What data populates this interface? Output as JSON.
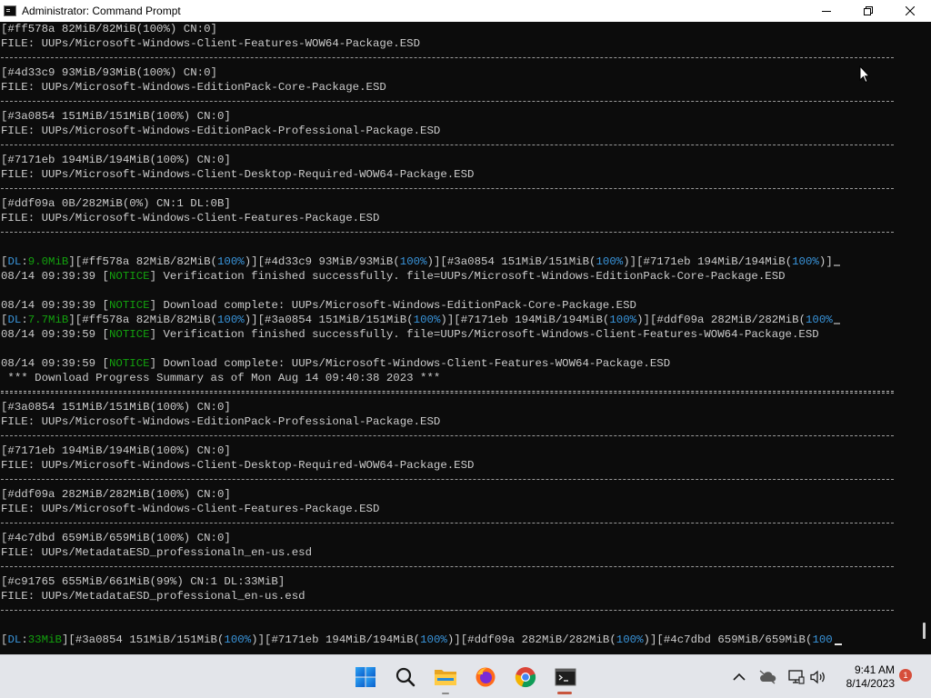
{
  "window": {
    "title": "Administrator: Command Prompt",
    "icon": "cmd-icon"
  },
  "console": {
    "blocks": [
      {
        "status": "[#ff578a 82MiB/82MiB(100%) CN:0]",
        "file": "FILE: UUPs/Microsoft-Windows-Client-Features-WOW64-Package.ESD"
      },
      {
        "status": "[#4d33c9 93MiB/93MiB(100%) CN:0]",
        "file": "FILE: UUPs/Microsoft-Windows-EditionPack-Core-Package.ESD"
      },
      {
        "status": "[#3a0854 151MiB/151MiB(100%) CN:0]",
        "file": "FILE: UUPs/Microsoft-Windows-EditionPack-Professional-Package.ESD"
      },
      {
        "status": "[#7171eb 194MiB/194MiB(100%) CN:0]",
        "file": "FILE: UUPs/Microsoft-Windows-Client-Desktop-Required-WOW64-Package.ESD"
      },
      {
        "status": "[#ddf09a 0B/282MiB(0%) CN:1 DL:0B]",
        "file": "FILE: UUPs/Microsoft-Windows-Client-Features-Package.ESD"
      }
    ],
    "progress1": {
      "dl": "9.0MiB",
      "items": [
        {
          "id": "#ff578a",
          "size": "82MiB/82MiB",
          "pct": "100%"
        },
        {
          "id": "#4d33c9",
          "size": "93MiB/93MiB",
          "pct": "100%"
        },
        {
          "id": "#3a0854",
          "size": "151MiB/151MiB",
          "pct": "100%"
        },
        {
          "id": "#7171eb",
          "size": "194MiB/194MiB",
          "pct": "100%"
        }
      ]
    },
    "log1": {
      "time": "08/14 09:39:39",
      "level": "NOTICE",
      "message": "Verification finished successfully. file=UUPs/Microsoft-Windows-EditionPack-Core-Package.ESD"
    },
    "log2": {
      "time": "08/14 09:39:39",
      "level": "NOTICE",
      "message": "Download complete: UUPs/Microsoft-Windows-EditionPack-Core-Package.ESD"
    },
    "progress2": {
      "dl": "7.7MiB",
      "items": [
        {
          "id": "#ff578a",
          "size": "82MiB/82MiB",
          "pct": "100%"
        },
        {
          "id": "#3a0854",
          "size": "151MiB/151MiB",
          "pct": "100%"
        },
        {
          "id": "#7171eb",
          "size": "194MiB/194MiB",
          "pct": "100%"
        },
        {
          "id": "#ddf09a",
          "size": "282MiB/282MiB",
          "pct": "100%"
        }
      ]
    },
    "log3": {
      "time": "08/14 09:39:59",
      "level": "NOTICE",
      "message": "Verification finished successfully. file=UUPs/Microsoft-Windows-Client-Features-WOW64-Package.ESD"
    },
    "log4": {
      "time": "08/14 09:39:59",
      "level": "NOTICE",
      "message": "Download complete: UUPs/Microsoft-Windows-Client-Features-WOW64-Package.ESD"
    },
    "summary": " *** Download Progress Summary as of Mon Aug 14 09:40:38 2023 ***",
    "blocks2": [
      {
        "status": "[#3a0854 151MiB/151MiB(100%) CN:0]",
        "file": "FILE: UUPs/Microsoft-Windows-EditionPack-Professional-Package.ESD"
      },
      {
        "status": "[#7171eb 194MiB/194MiB(100%) CN:0]",
        "file": "FILE: UUPs/Microsoft-Windows-Client-Desktop-Required-WOW64-Package.ESD"
      },
      {
        "status": "[#ddf09a 282MiB/282MiB(100%) CN:0]",
        "file": "FILE: UUPs/Microsoft-Windows-Client-Features-Package.ESD"
      },
      {
        "status": "[#4c7dbd 659MiB/659MiB(100%) CN:0]",
        "file": "FILE: UUPs/MetadataESD_professionaln_en-us.esd"
      },
      {
        "status": "[#c91765 655MiB/661MiB(99%) CN:1 DL:33MiB]",
        "file": "FILE: UUPs/MetadataESD_professional_en-us.esd"
      }
    ],
    "progress3": {
      "dl": "33MiB",
      "items": [
        {
          "id": "#3a0854",
          "size": "151MiB/151MiB",
          "pct": "100%"
        },
        {
          "id": "#7171eb",
          "size": "194MiB/194MiB",
          "pct": "100%"
        },
        {
          "id": "#ddf09a",
          "size": "282MiB/282MiB",
          "pct": "100%"
        }
      ],
      "last_id": "#4c7dbd",
      "last_size": "659MiB/659MiB",
      "last_pct_partial": "100"
    }
  },
  "taskbar": {
    "apps": [
      "start-icon",
      "search-icon",
      "file-explorer-icon",
      "firefox-icon",
      "chrome-icon",
      "terminal-icon"
    ],
    "clock_time": "9:41 AM",
    "clock_date": "8/14/2023",
    "notification_count": "1",
    "colors": {
      "active": "#c8553d",
      "badge": "#d64e3b"
    }
  },
  "colors": {
    "console_bg": "#0c0c0c",
    "console_text": "#cccccc",
    "cyan": "#3a96dd",
    "green": "#13a10e"
  }
}
